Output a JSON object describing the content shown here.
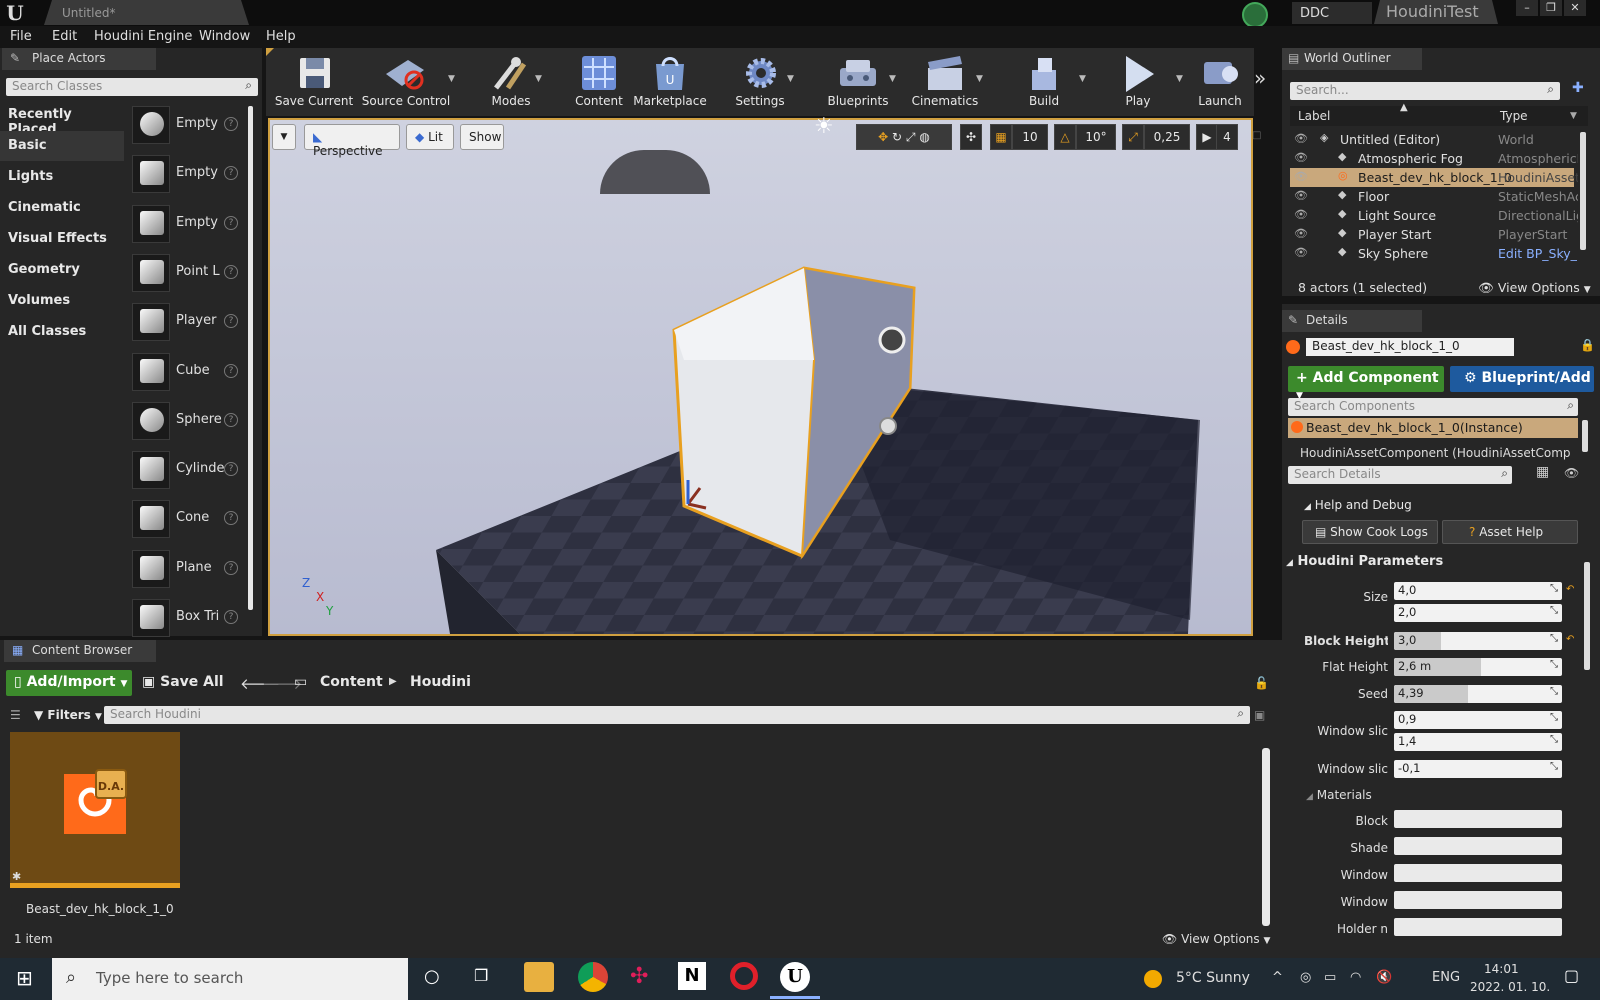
{
  "titlebar": {
    "doc_tab": "Untitled*",
    "ddc": "DDC",
    "project": "HoudiniTest",
    "minimize": "–",
    "restore": "❐",
    "close": "✕"
  },
  "menu": [
    "File",
    "Edit",
    "Houdini Engine",
    "Window",
    "Help"
  ],
  "place_actors": {
    "tab": "Place Actors",
    "search_placeholder": "Search Classes",
    "categories": [
      "Recently Placed",
      "Basic",
      "Lights",
      "Cinematic",
      "Visual Effects",
      "Geometry",
      "Volumes",
      "All Classes"
    ],
    "selected_category": "Basic",
    "actors": [
      {
        "label": "Empty",
        "icon": "sphere-icon"
      },
      {
        "label": "Empty",
        "icon": "character-icon"
      },
      {
        "label": "Empty",
        "icon": "pawn-icon"
      },
      {
        "label": "Point L",
        "icon": "lightbulb-icon"
      },
      {
        "label": "Player",
        "icon": "player-start-icon"
      },
      {
        "label": "Cube",
        "icon": "cube-icon"
      },
      {
        "label": "Sphere",
        "icon": "sphere-icon"
      },
      {
        "label": "Cylinde",
        "icon": "cylinder-icon"
      },
      {
        "label": "Cone",
        "icon": "cone-icon"
      },
      {
        "label": "Plane",
        "icon": "plane-icon"
      },
      {
        "label": "Box Tri",
        "icon": "box-trigger-icon"
      }
    ]
  },
  "toolbar": {
    "tools": [
      "Save Current",
      "Source Control",
      "Modes",
      "Content",
      "Marketplace",
      "Settings",
      "Blueprints",
      "Cinematics",
      "Build",
      "Play",
      "Launch"
    ],
    "more": "»"
  },
  "viewport": {
    "perspective": "Perspective",
    "lit": "Lit",
    "show": "Show",
    "grid_snap": "10",
    "rot_snap": "10°",
    "scale_snap": "0,25",
    "cam_speed": "4",
    "axis": {
      "z": "Z",
      "x": "X",
      "y": "Y"
    }
  },
  "outliner": {
    "tab": "World Outliner",
    "search_placeholder": "Search...",
    "col_label": "Label",
    "col_type": "Type",
    "rows": [
      {
        "name": "Untitled (Editor)",
        "type": "World"
      },
      {
        "name": "Atmospheric Fog",
        "type": "AtmosphericF"
      },
      {
        "name": "Beast_dev_hk_block_1_0",
        "type": "HoudiniAsset"
      },
      {
        "name": "Floor",
        "type": "StaticMeshAc"
      },
      {
        "name": "Light Source",
        "type": "DirectionalLig"
      },
      {
        "name": "Player Start",
        "type": "PlayerStart"
      },
      {
        "name": "Sky Sphere",
        "type": "Edit BP_Sky_"
      }
    ],
    "selected_row": 2,
    "status": "8 actors (1 selected)",
    "view_options": "View Options"
  },
  "details": {
    "tab": "Details",
    "actor_name": "Beast_dev_hk_block_1_0",
    "add_component": "Add Component",
    "blueprint": "Blueprint/Add",
    "search_components": "Search Components",
    "component_instance": "Beast_dev_hk_block_1_0(Instance)",
    "component_child": "HoudiniAssetComponent (HoudiniAssetComp",
    "search_details": "Search Details",
    "help_debug": "Help and Debug",
    "show_cook_logs": "Show Cook Logs",
    "asset_help": "Asset Help",
    "houdini_params": "Houdini Parameters",
    "params": {
      "size_label": "Size",
      "size_a": "4,0",
      "size_b": "2,0",
      "block_height_label": "Block Height",
      "block_height": "3,0",
      "block_height_fill": 0.28,
      "flat_height_label": "Flat Height",
      "flat_height": "2,6 m",
      "flat_height_fill": 0.52,
      "seed_label": "Seed",
      "seed": "4,39",
      "seed_fill": 0.44,
      "window_slice_label": "Window slic",
      "window_slice_a": "0,9",
      "window_slice_b": "1,4",
      "window_slice2_label": "Window slic",
      "window_slice2": "-0,1"
    },
    "materials": {
      "label": "Materials",
      "items": [
        "Block",
        "Shade",
        "Window",
        "Window",
        "Holder n"
      ]
    }
  },
  "content_browser": {
    "tab": "Content Browser",
    "add_import": "Add/Import",
    "save_all": "Save All",
    "path": [
      "Content",
      "Houdini"
    ],
    "filters": "Filters",
    "search_placeholder": "Search Houdini",
    "asset_name": "Beast_dev_hk_block_1_0",
    "item_count": "1 item",
    "view_options": "View Options"
  },
  "taskbar": {
    "search_placeholder": "Type here to search",
    "weather": "5°C  Sunny",
    "lang": "ENG",
    "time": "14:01",
    "date": "2022. 01. 10."
  },
  "colors": {
    "accent_green": "#3c8a2c",
    "accent_blue": "#1e5a9e",
    "selection": "#c9a87c",
    "houdini_orange": "#ff6a1a"
  }
}
